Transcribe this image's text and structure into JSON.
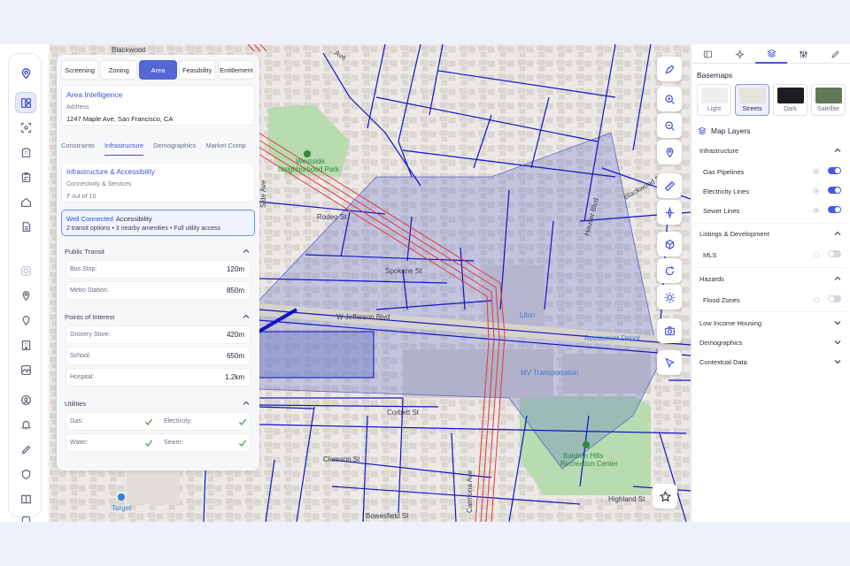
{
  "panel": {
    "tabs": [
      "Screening",
      "Zoning",
      "Area",
      "Feasibility",
      "Entitlement"
    ],
    "active_tab": "Area",
    "area_intel": {
      "title": "Area Intelligence",
      "address_label": "Address",
      "address": "1247 Maple Ave, San Francisco, CA"
    },
    "subtabs": [
      "Constraints",
      "Infrastructure",
      "Demographics",
      "Market Comp"
    ],
    "active_subtab": "Infrastructure",
    "infra": {
      "title": "Infrastructure & Accessibility",
      "subtitle": "Connectivity & Services",
      "score": "7",
      "score_suffix": "out of 10"
    },
    "well_connected": {
      "badge": "Well Connected",
      "label": "Accessibility",
      "detail": "2 transit options • 3 nearby amenities • Full utility access"
    },
    "public_transit": {
      "title": "Public Transit",
      "rows": [
        {
          "k": "Bus Stop:",
          "v": "120m"
        },
        {
          "k": "Metro Station:",
          "v": "850m"
        }
      ]
    },
    "poi": {
      "title": "Points of Interest",
      "rows": [
        {
          "k": "Grocery Store:",
          "v": "420m"
        },
        {
          "k": "School:",
          "v": "650m"
        },
        {
          "k": "Hospital:",
          "v": "1.2km"
        }
      ]
    },
    "utilities": {
      "title": "Utilities",
      "items": [
        "Gas:",
        "Electricity:",
        "Water:",
        "Sewer:"
      ]
    }
  },
  "map": {
    "labels": {
      "blackwood_top": "Blackwood",
      "ave_top": "...Ave",
      "westside": "Westside",
      "neighborhood_park": "Neighborhood Park",
      "rodeo": "Rodeo St",
      "spokane": "Spokane St",
      "jefferson": "W Jefferson Blvd",
      "liton": "Liton",
      "restaurant_depot": "Restaurant Depot",
      "mv_transportation": "MV Transportation",
      "corbett": "Corbett St",
      "clemson": "Clemson St",
      "carmona": "Carmona Ave",
      "bowesfield": "Bowesfield St",
      "baldwin": "Baldwin Hills",
      "recreation": "Recreation Center",
      "highland": "Highland St",
      "target": "Target",
      "blackwood_right": "Blackwood St",
      "hauser": "Hauser Blvd",
      "side_ave": "Side Ave"
    },
    "colors": {
      "roads": "#1414c8",
      "pipelines": "#e03a3a",
      "parcel": "#5a66c8",
      "park": "#b8dbb0"
    }
  },
  "tools": [
    "draw-icon",
    "zoom-in-icon",
    "zoom-out-icon",
    "location-icon",
    "ruler-icon",
    "compass-icon",
    "cube-icon",
    "rotate-icon",
    "sun-icon",
    "camera-icon",
    "cursor-icon"
  ],
  "right": {
    "basemaps_title": "Basemaps",
    "basemaps": [
      {
        "name": "Light",
        "color": "#eeeeee"
      },
      {
        "name": "Streets",
        "color": "#e6e2dc"
      },
      {
        "name": "Dark",
        "color": "#1e1e22"
      },
      {
        "name": "Satellite",
        "color": "#5f7a55"
      }
    ],
    "active_basemap": "Streets",
    "map_layers_title": "Map Layers",
    "groups": {
      "infrastructure": {
        "title": "Infrastructure",
        "layers": [
          {
            "name": "Gas Pipelines",
            "on": true
          },
          {
            "name": "Electricity Lines",
            "on": true
          },
          {
            "name": "Sewer Lines",
            "on": true
          }
        ]
      },
      "listings": {
        "title": "Listings & Development",
        "layers": [
          {
            "name": "MLS",
            "on": false
          }
        ]
      },
      "hazards": {
        "title": "Hazards",
        "layers": [
          {
            "name": "Flood Zones",
            "on": false
          }
        ]
      },
      "low_income": {
        "title": "Low Income Housing"
      },
      "demographics": {
        "title": "Demographics"
      },
      "contextual": {
        "title": "Contextual Data"
      }
    }
  }
}
